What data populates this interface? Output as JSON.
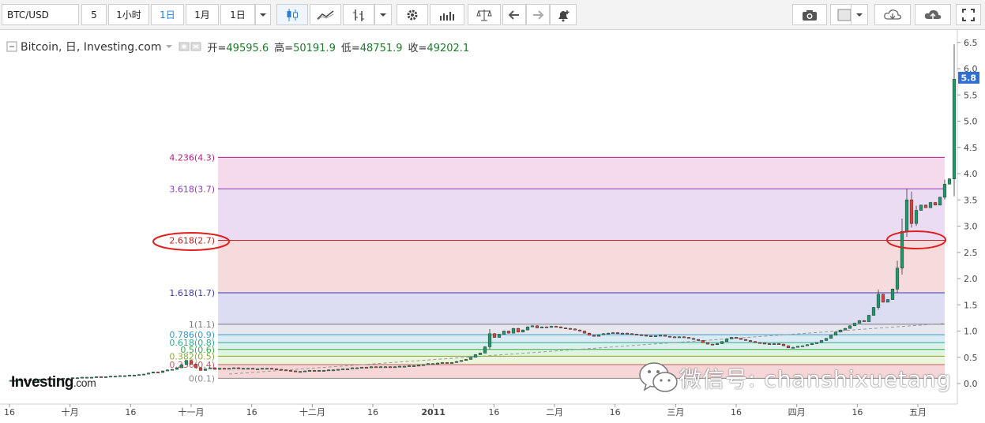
{
  "toolbar": {
    "symbol": "BTC/USD",
    "period_value": "5",
    "intervals": [
      "1小时",
      "1日",
      "1月",
      "1日"
    ],
    "active_interval_index": 1
  },
  "legend": {
    "title": "Bitcoin, 日, Investing.com",
    "open_label": "开=",
    "open": "49595.6",
    "high_label": "高=",
    "high": "50191.9",
    "low_label": "低=",
    "low": "48751.9",
    "close_label": "收=",
    "close": "49202.1"
  },
  "colors": {
    "up": "#1a9a6a",
    "down": "#e0403a",
    "current_price_box": "#2f6fd3",
    "circle": "#e02020"
  },
  "chart_data": {
    "type": "candlestick",
    "y_axis": {
      "range": [
        -0.3,
        6.65
      ],
      "ticks": [
        "0.0",
        "0.5",
        "1.0",
        "1.5",
        "2.0",
        "2.5",
        "3.0",
        "3.5",
        "4.0",
        "4.5",
        "5.0",
        "5.5",
        "6.0",
        "6.5"
      ],
      "current_price_label": "5.8"
    },
    "x_axis": {
      "ticks": [
        "16",
        "十月",
        "16",
        "十一月",
        "16",
        "十二月",
        "16",
        "2011",
        "16",
        "二月",
        "16",
        "三月",
        "16",
        "四月",
        "16",
        "五月"
      ]
    },
    "fibonacci": [
      {
        "label": "0(0.1)",
        "value": 0.1,
        "line": "#888888",
        "fill": "rgba(255,255,255,0)"
      },
      {
        "label": "0.236(0.4)",
        "value": 0.36,
        "line": "#c06060",
        "fill": "#f5cfcf"
      },
      {
        "label": "0.382(0.5)",
        "value": 0.52,
        "line": "#8aa83a",
        "fill": "#e6f3d2"
      },
      {
        "label": "0.5(0.6)",
        "value": 0.65,
        "line": "#3aa84a",
        "fill": "#d9f1dc"
      },
      {
        "label": "0.618(0.8)",
        "value": 0.78,
        "line": "#2ea88a",
        "fill": "#d3efe9"
      },
      {
        "label": "0.786(0.9)",
        "value": 0.93,
        "line": "#3a98c8",
        "fill": "#d3e8f3"
      },
      {
        "label": "1(1.1)",
        "value": 1.13,
        "line": "#7a7a7a",
        "fill": "#e3e3ec"
      },
      {
        "label": "1.618(1.7)",
        "value": 1.73,
        "line": "#3a3aa8",
        "fill": "#d6d6f1"
      },
      {
        "label": "2.618(2.7)",
        "value": 2.73,
        "line": "#c02020",
        "fill": "#f3d5d5"
      },
      {
        "label": "3.618(3.7)",
        "value": 3.71,
        "line": "#8a3ab0",
        "fill": "#e8d6f1"
      },
      {
        "label": "4.236(4.3)",
        "value": 4.31,
        "line": "#b02080",
        "fill": "#f3d3e8"
      }
    ],
    "candles": [
      [
        0.06,
        0.06
      ],
      [
        0.06,
        0.06
      ],
      [
        0.06,
        0.07
      ],
      [
        0.07,
        0.06
      ],
      [
        0.06,
        0.07
      ],
      [
        0.07,
        0.07
      ],
      [
        0.07,
        0.08
      ],
      [
        0.08,
        0.08
      ],
      [
        0.08,
        0.09
      ],
      [
        0.09,
        0.09
      ],
      [
        0.09,
        0.1
      ],
      [
        0.1,
        0.1
      ],
      [
        0.1,
        0.1
      ],
      [
        0.1,
        0.11
      ],
      [
        0.11,
        0.11
      ],
      [
        0.11,
        0.12
      ],
      [
        0.12,
        0.12
      ],
      [
        0.12,
        0.12
      ],
      [
        0.12,
        0.13
      ],
      [
        0.13,
        0.12
      ],
      [
        0.12,
        0.13
      ],
      [
        0.13,
        0.14
      ],
      [
        0.14,
        0.14
      ],
      [
        0.14,
        0.15
      ],
      [
        0.15,
        0.15
      ],
      [
        0.15,
        0.16
      ],
      [
        0.16,
        0.16
      ],
      [
        0.16,
        0.17
      ],
      [
        0.17,
        0.18
      ],
      [
        0.18,
        0.2
      ],
      [
        0.2,
        0.22
      ],
      [
        0.22,
        0.21
      ],
      [
        0.21,
        0.24
      ],
      [
        0.24,
        0.26
      ],
      [
        0.26,
        0.27
      ],
      [
        0.27,
        0.3
      ],
      [
        0.3,
        0.36
      ],
      [
        0.36,
        0.44
      ],
      [
        0.44,
        0.37
      ],
      [
        0.37,
        0.3
      ],
      [
        0.3,
        0.25
      ],
      [
        0.25,
        0.28
      ],
      [
        0.28,
        0.3
      ],
      [
        0.3,
        0.27
      ],
      [
        0.27,
        0.29
      ],
      [
        0.29,
        0.28
      ],
      [
        0.28,
        0.29
      ],
      [
        0.29,
        0.3
      ],
      [
        0.3,
        0.28
      ],
      [
        0.28,
        0.29
      ],
      [
        0.29,
        0.29
      ],
      [
        0.29,
        0.28
      ],
      [
        0.28,
        0.28
      ],
      [
        0.28,
        0.29
      ],
      [
        0.29,
        0.29
      ],
      [
        0.29,
        0.28
      ],
      [
        0.28,
        0.27
      ],
      [
        0.27,
        0.26
      ],
      [
        0.26,
        0.25
      ],
      [
        0.25,
        0.24
      ],
      [
        0.24,
        0.23
      ],
      [
        0.23,
        0.23
      ],
      [
        0.23,
        0.24
      ],
      [
        0.24,
        0.25
      ],
      [
        0.25,
        0.24
      ],
      [
        0.24,
        0.25
      ],
      [
        0.25,
        0.25
      ],
      [
        0.25,
        0.26
      ],
      [
        0.26,
        0.26
      ],
      [
        0.26,
        0.27
      ],
      [
        0.27,
        0.28
      ],
      [
        0.28,
        0.28
      ],
      [
        0.28,
        0.3
      ],
      [
        0.3,
        0.3
      ],
      [
        0.3,
        0.31
      ],
      [
        0.31,
        0.3
      ],
      [
        0.3,
        0.32
      ],
      [
        0.32,
        0.31
      ],
      [
        0.31,
        0.32
      ],
      [
        0.32,
        0.32
      ],
      [
        0.32,
        0.31
      ],
      [
        0.31,
        0.32
      ],
      [
        0.32,
        0.33
      ],
      [
        0.33,
        0.33
      ],
      [
        0.33,
        0.34
      ],
      [
        0.34,
        0.34
      ],
      [
        0.34,
        0.35
      ],
      [
        0.35,
        0.36
      ],
      [
        0.36,
        0.38
      ],
      [
        0.38,
        0.38
      ],
      [
        0.38,
        0.39
      ],
      [
        0.39,
        0.4
      ],
      [
        0.4,
        0.39
      ],
      [
        0.39,
        0.4
      ],
      [
        0.4,
        0.42
      ],
      [
        0.42,
        0.44
      ],
      [
        0.44,
        0.46
      ],
      [
        0.46,
        0.5
      ],
      [
        0.5,
        0.55
      ],
      [
        0.55,
        0.58
      ],
      [
        0.58,
        0.7
      ],
      [
        0.7,
        0.95
      ],
      [
        0.95,
        0.88
      ],
      [
        0.88,
        0.94
      ],
      [
        0.94,
        1.0
      ],
      [
        1.0,
        0.96
      ],
      [
        0.96,
        1.05
      ],
      [
        1.05,
        0.98
      ],
      [
        0.98,
        1.02
      ],
      [
        1.02,
        1.08
      ],
      [
        1.08,
        1.1
      ],
      [
        1.1,
        1.06
      ],
      [
        1.06,
        1.08
      ],
      [
        1.08,
        1.07
      ],
      [
        1.07,
        1.09
      ],
      [
        1.09,
        1.08
      ],
      [
        1.08,
        1.06
      ],
      [
        1.06,
        1.05
      ],
      [
        1.05,
        1.04
      ],
      [
        1.04,
        1.02
      ],
      [
        1.02,
        1.0
      ],
      [
        1.0,
        0.96
      ],
      [
        0.96,
        0.92
      ],
      [
        0.92,
        0.9
      ],
      [
        0.9,
        0.93
      ],
      [
        0.93,
        0.95
      ],
      [
        0.95,
        0.96
      ],
      [
        0.96,
        0.97
      ],
      [
        0.97,
        0.95
      ],
      [
        0.95,
        0.96
      ],
      [
        0.96,
        0.95
      ],
      [
        0.95,
        0.94
      ],
      [
        0.94,
        0.93
      ],
      [
        0.93,
        0.92
      ],
      [
        0.92,
        0.91
      ],
      [
        0.91,
        0.9
      ],
      [
        0.9,
        0.91
      ],
      [
        0.91,
        0.92
      ],
      [
        0.92,
        0.9
      ],
      [
        0.9,
        0.89
      ],
      [
        0.89,
        0.88
      ],
      [
        0.88,
        0.89
      ],
      [
        0.89,
        0.88
      ],
      [
        0.88,
        0.86
      ],
      [
        0.86,
        0.84
      ],
      [
        0.84,
        0.82
      ],
      [
        0.82,
        0.78
      ],
      [
        0.78,
        0.75
      ],
      [
        0.75,
        0.74
      ],
      [
        0.74,
        0.76
      ],
      [
        0.76,
        0.8
      ],
      [
        0.8,
        0.85
      ],
      [
        0.85,
        0.88
      ],
      [
        0.88,
        0.86
      ],
      [
        0.86,
        0.84
      ],
      [
        0.84,
        0.82
      ],
      [
        0.82,
        0.8
      ],
      [
        0.8,
        0.78
      ],
      [
        0.78,
        0.77
      ],
      [
        0.77,
        0.76
      ],
      [
        0.76,
        0.75
      ],
      [
        0.75,
        0.76
      ],
      [
        0.76,
        0.75
      ],
      [
        0.75,
        0.72
      ],
      [
        0.72,
        0.68
      ],
      [
        0.68,
        0.69
      ],
      [
        0.69,
        0.71
      ],
      [
        0.71,
        0.72
      ],
      [
        0.72,
        0.74
      ],
      [
        0.74,
        0.76
      ],
      [
        0.76,
        0.78
      ],
      [
        0.78,
        0.82
      ],
      [
        0.82,
        0.86
      ],
      [
        0.86,
        0.92
      ],
      [
        0.92,
        0.98
      ],
      [
        0.98,
        1.02
      ],
      [
        1.02,
        1.05
      ],
      [
        1.05,
        1.1
      ],
      [
        1.1,
        1.15
      ],
      [
        1.15,
        1.2
      ],
      [
        1.2,
        1.18
      ],
      [
        1.18,
        1.3
      ],
      [
        1.3,
        1.45
      ],
      [
        1.45,
        1.7
      ],
      [
        1.7,
        1.55
      ],
      [
        1.55,
        1.6
      ],
      [
        1.6,
        1.8
      ],
      [
        1.8,
        2.2
      ],
      [
        2.2,
        2.9
      ],
      [
        2.9,
        3.5
      ],
      [
        3.5,
        3.05
      ],
      [
        3.05,
        3.3
      ],
      [
        3.3,
        3.4
      ],
      [
        3.4,
        3.35
      ],
      [
        3.35,
        3.45
      ],
      [
        3.45,
        3.4
      ],
      [
        3.4,
        3.55
      ],
      [
        3.55,
        3.8
      ],
      [
        3.8,
        3.9
      ],
      [
        3.9,
        5.8
      ]
    ]
  },
  "brand": {
    "name": "Investing",
    "suffix": ".com"
  },
  "watermark": {
    "text": "微信号: chanshixuetang"
  }
}
